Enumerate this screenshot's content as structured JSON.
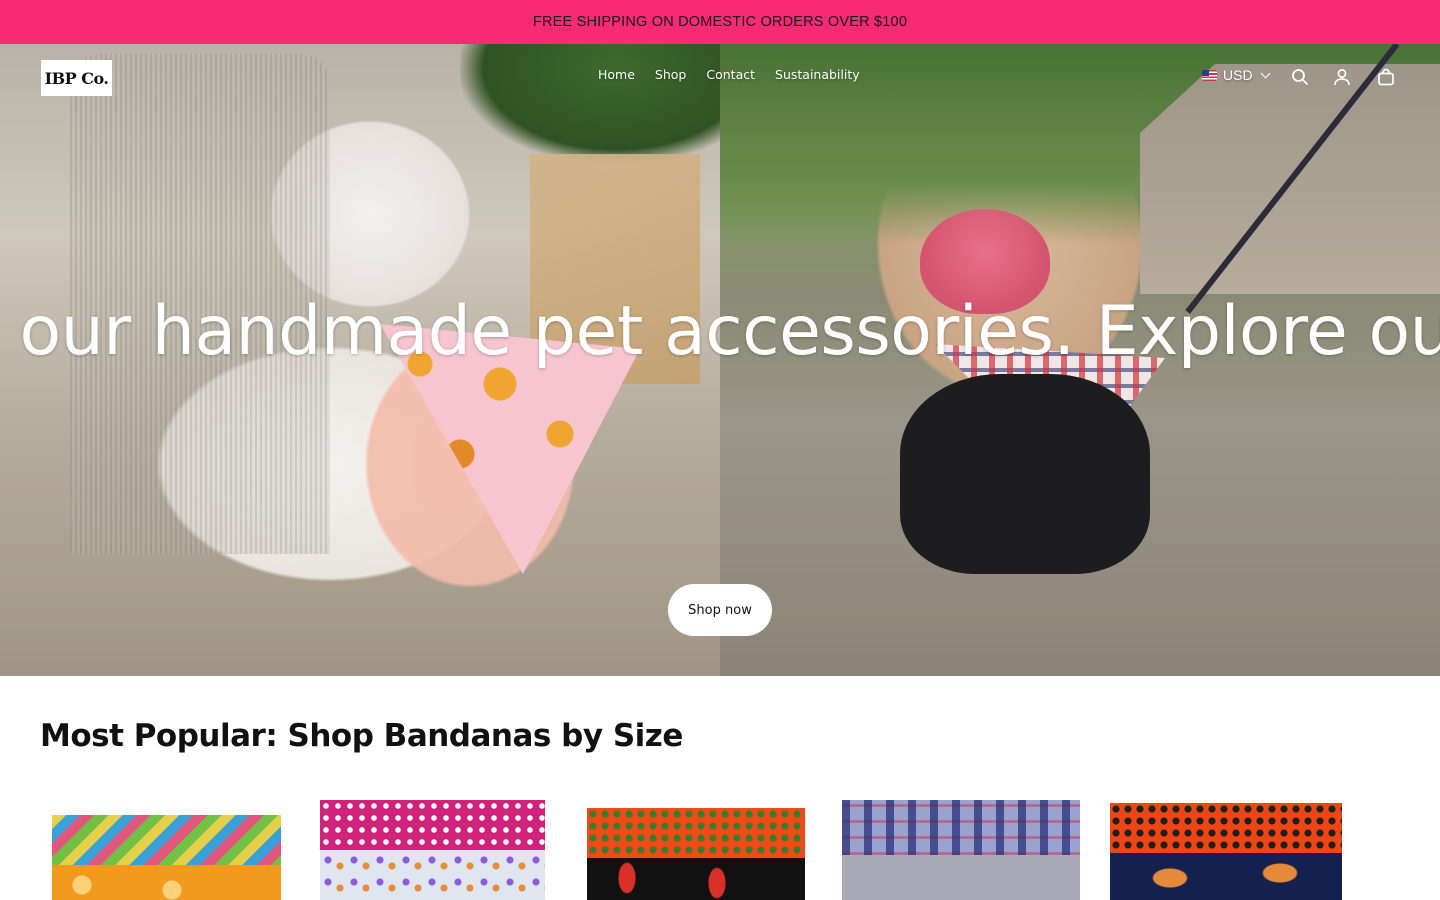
{
  "announcement": {
    "text": "FREE SHIPPING ON DOMESTIC ORDERS OVER $100"
  },
  "header": {
    "logo_text": "IBP Co.",
    "nav": [
      "Home",
      "Shop",
      "Contact",
      "Sustainability"
    ],
    "currency": "USD",
    "icons": [
      "search-icon",
      "account-icon",
      "cart-icon"
    ]
  },
  "hero": {
    "marquee": "ore our handmade pet accessories. Explore our han",
    "cta": "Shop now"
  },
  "section": {
    "title": "Most Popular: Shop Bandanas by Size"
  },
  "colors": {
    "announcement_bg": "#f72a72",
    "text": "#111111",
    "background": "#ffffff"
  }
}
